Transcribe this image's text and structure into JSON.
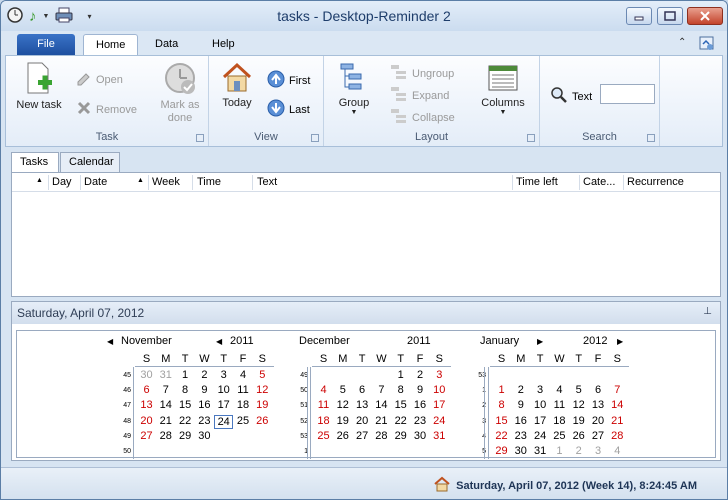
{
  "window": {
    "title": "tasks - Desktop-Reminder 2"
  },
  "tabs": {
    "file": "File",
    "home": "Home",
    "data": "Data",
    "help": "Help"
  },
  "ribbon": {
    "task": {
      "label": "Task",
      "new_task": "New task",
      "open": "Open",
      "remove": "Remove",
      "mark_done": "Mark as done"
    },
    "view": {
      "label": "View",
      "today": "Today",
      "first": "First",
      "last": "Last"
    },
    "layout": {
      "label": "Layout",
      "group": "Group",
      "ungroup": "Ungroup",
      "expand": "Expand",
      "collapse": "Collapse",
      "columns": "Columns"
    },
    "search": {
      "label": "Search",
      "text_label": "Text",
      "value": ""
    }
  },
  "pane_tabs": {
    "tasks": "Tasks",
    "calendar": "Calendar"
  },
  "grid_columns": [
    "Day",
    "Date",
    "Week",
    "Time",
    "Text",
    "Time left",
    "Cate...",
    "Recurrence"
  ],
  "date_panel": {
    "title": "Saturday, April 07, 2012"
  },
  "weekdays": [
    "S",
    "M",
    "T",
    "W",
    "T",
    "F",
    "S"
  ],
  "calendars": [
    {
      "month": "November",
      "year": "2011",
      "weeks": [
        "45",
        "46",
        "47",
        "48",
        "49",
        "50"
      ],
      "rows": [
        [
          "30",
          "31",
          "1",
          "2",
          "3",
          "4",
          "5"
        ],
        [
          "6",
          "7",
          "8",
          "9",
          "10",
          "11",
          "12"
        ],
        [
          "13",
          "14",
          "15",
          "16",
          "17",
          "18",
          "19"
        ],
        [
          "20",
          "21",
          "22",
          "23",
          "24",
          "25",
          "26"
        ],
        [
          "27",
          "28",
          "29",
          "30",
          "",
          "",
          ""
        ],
        [
          "",
          "",
          "",
          "",
          "",
          "",
          ""
        ]
      ]
    },
    {
      "month": "December",
      "year": "2011",
      "weeks": [
        "49",
        "50",
        "51",
        "52",
        "53",
        "1"
      ],
      "rows": [
        [
          "",
          "",
          "",
          "",
          "1",
          "2",
          "3"
        ],
        [
          "4",
          "5",
          "6",
          "7",
          "8",
          "9",
          "10"
        ],
        [
          "11",
          "12",
          "13",
          "14",
          "15",
          "16",
          "17"
        ],
        [
          "18",
          "19",
          "20",
          "21",
          "22",
          "23",
          "24"
        ],
        [
          "25",
          "26",
          "27",
          "28",
          "29",
          "30",
          "31"
        ],
        [
          "",
          "",
          "",
          "",
          "",
          "",
          ""
        ]
      ]
    },
    {
      "month": "January",
      "year": "2012",
      "weeks": [
        "53",
        "1",
        "2",
        "3",
        "4",
        "5"
      ],
      "rows": [
        [
          "",
          "",
          "",
          "",
          "",
          "",
          ""
        ],
        [
          "1",
          "2",
          "3",
          "4",
          "5",
          "6",
          "7"
        ],
        [
          "8",
          "9",
          "10",
          "11",
          "12",
          "13",
          "14"
        ],
        [
          "15",
          "16",
          "17",
          "18",
          "19",
          "20",
          "21"
        ],
        [
          "22",
          "23",
          "24",
          "25",
          "26",
          "27",
          "28"
        ],
        [
          "29",
          "30",
          "31",
          "1",
          "2",
          "3",
          "4"
        ]
      ]
    }
  ],
  "status": {
    "datetime": "Saturday, April 07, 2012 (Week 14), 8:24:45 AM"
  }
}
